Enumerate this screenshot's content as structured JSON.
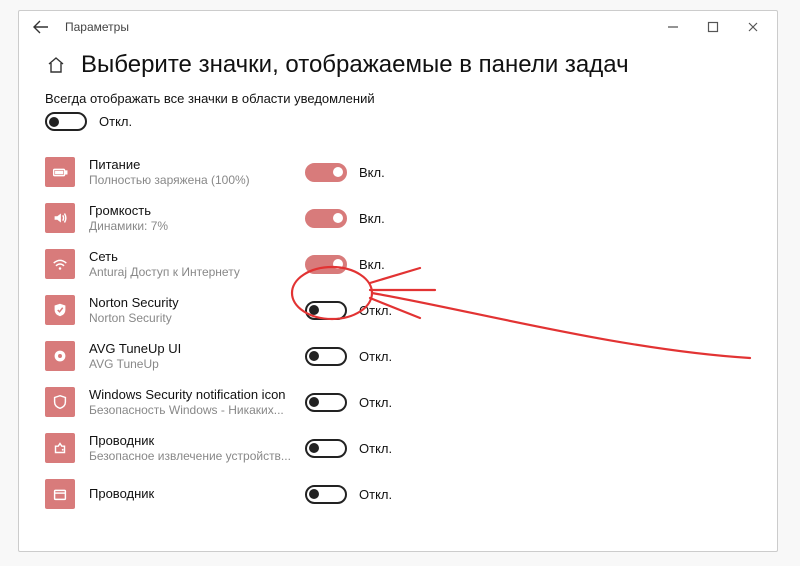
{
  "window": {
    "title": "Параметры"
  },
  "page": {
    "heading": "Выберите значки, отображаемые в панели задач",
    "always_show": "Всегда отображать все значки в области уведомлений",
    "master_toggle_label": "Откл."
  },
  "labels": {
    "on": "Вкл.",
    "off": "Откл."
  },
  "items": [
    {
      "title": "Питание",
      "sub": "Полностью заряжена (100%)",
      "on": true,
      "icon": "battery"
    },
    {
      "title": "Громкость",
      "sub": "Динамики: 7%",
      "on": true,
      "icon": "speaker"
    },
    {
      "title": "Сеть",
      "sub": "Anturaj Доступ к Интернету",
      "on": true,
      "icon": "wifi"
    },
    {
      "title": "Norton Security",
      "sub": "Norton Security",
      "on": false,
      "icon": "shield"
    },
    {
      "title": "AVG TuneUp UI",
      "sub": "AVG TuneUp",
      "on": false,
      "icon": "tune"
    },
    {
      "title": "Windows Security notification icon",
      "sub": "Безопасность Windows - Никаких...",
      "on": false,
      "icon": "winsec"
    },
    {
      "title": "Проводник",
      "sub": "Безопасное извлечение устройств...",
      "on": false,
      "icon": "eject"
    },
    {
      "title": "Проводник",
      "sub": "",
      "on": false,
      "icon": "explorer"
    }
  ]
}
